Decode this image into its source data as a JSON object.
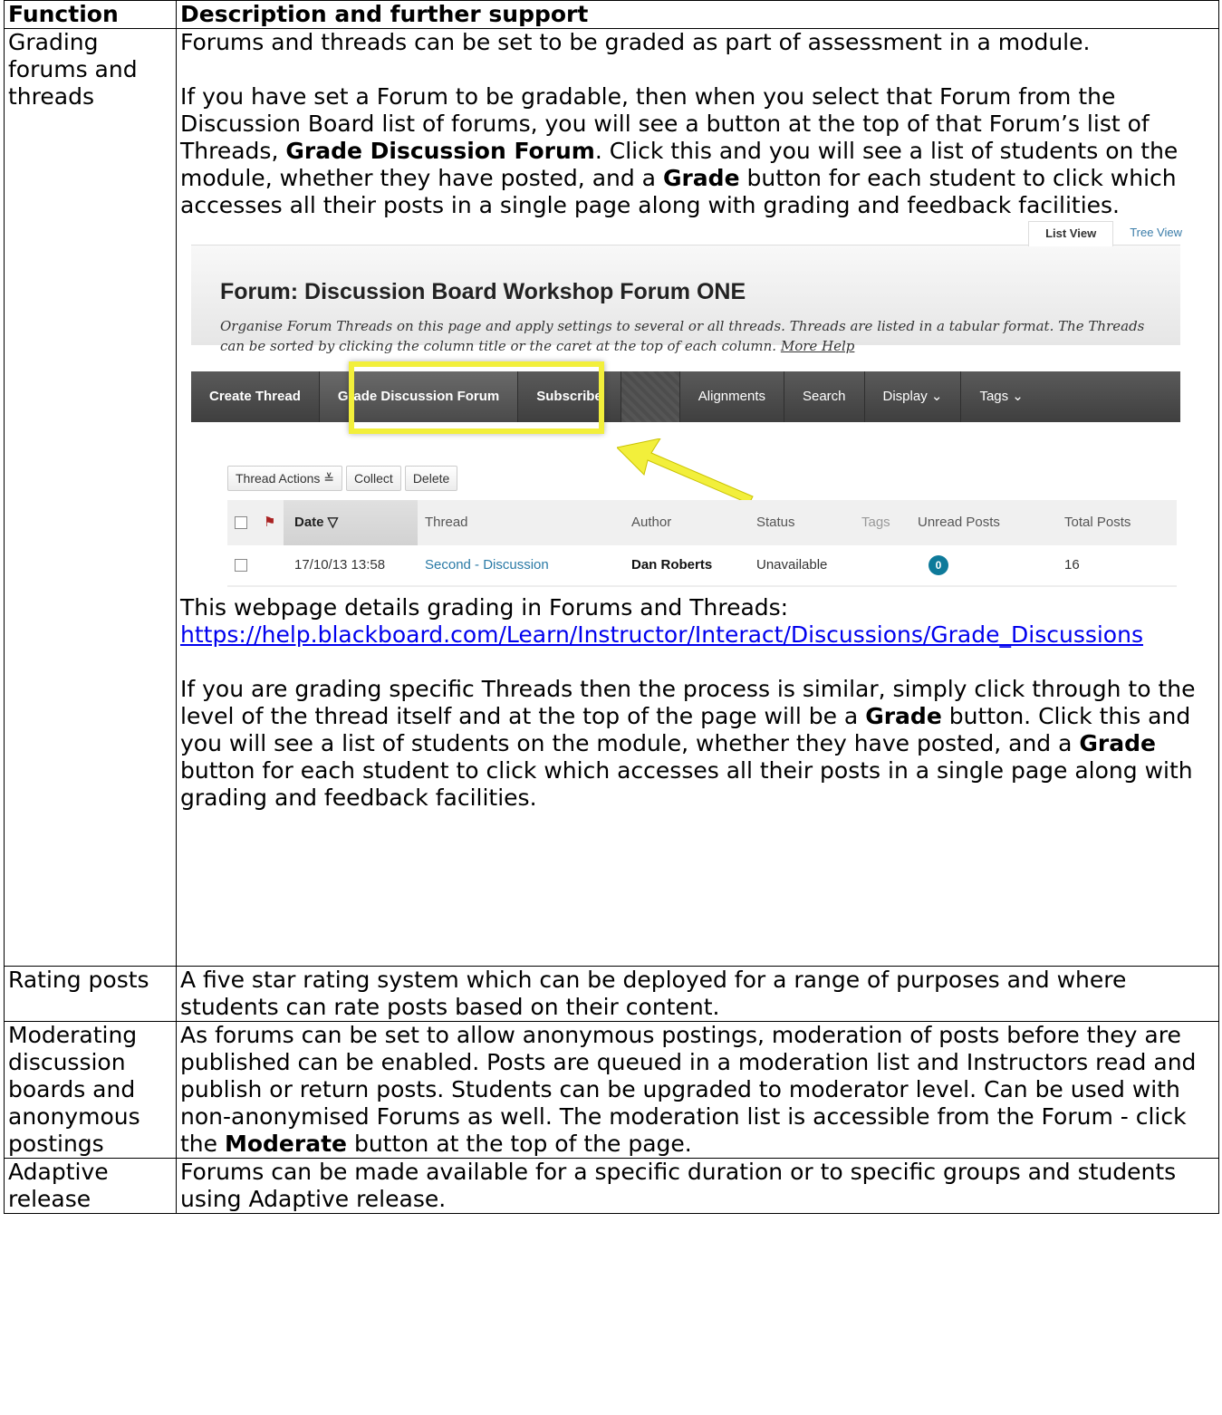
{
  "table": {
    "headers": {
      "function": "Function",
      "description": "Description and further support"
    }
  },
  "grading": {
    "function": "Grading forums and threads",
    "p1": "Forums and threads can be set to be graded as part of assessment in a module.",
    "p2_a": "If you have set a Forum to be gradable, then when you select that Forum from the Discussion Board list of forums, you will see a button at the top of that Forum’s list of Threads, ",
    "p2_b": "Grade Discussion Forum",
    "p2_c": ". Click this and you will see a list of students on the module, whether they have posted, and a ",
    "p2_d": "Grade",
    "p2_e": " button for each student to click which accesses all their posts in a single page along with grading and feedback facilities.",
    "p3": "This webpage  details grading in Forums and Threads:",
    "link": "https://help.blackboard.com/Learn/Instructor/Interact/Discussions/Grade_Discussions",
    "p4_a": "If you are grading specific Threads then the process is similar, simply click through to the level of the thread itself and at the top of the page will be a ",
    "p4_b": "Grade",
    "p4_c": " button. Click this and you will see a list of students on the module, whether they have posted, and a ",
    "p4_d": "Grade",
    "p4_e": " button for each student to click which accesses all their posts in a single page along with grading and feedback facilities."
  },
  "screenshot": {
    "view_tabs": [
      "List View",
      "Tree View"
    ],
    "forum_title": "Forum: Discussion Board Workshop Forum ONE",
    "forum_desc": "Organise Forum Threads on this page and apply settings to several or all threads. Threads are listed in a tabular format. The Threads can be sorted by clicking the column title or the caret at the top of each column.",
    "more_help": "More Help",
    "nav": {
      "create_thread": "Create Thread",
      "grade_forum": "Grade Discussion Forum",
      "subscribe": "Subscribe",
      "alignments": "Alignments",
      "search": "Search",
      "display": "Display ⌄",
      "tags": "Tags ⌄"
    },
    "actions": {
      "thread_actions": "Thread Actions ≚",
      "collect": "Collect",
      "delete": "Delete"
    },
    "columns": {
      "date": "Date ▽",
      "thread": "Thread",
      "author": "Author",
      "status": "Status",
      "tags": "Tags",
      "unread": "Unread Posts",
      "total": "Total Posts"
    },
    "row": {
      "date": "17/10/13 13:58",
      "thread": "Second - Discussion",
      "author": "Dan Roberts",
      "status": "Unavailable",
      "unread": "0",
      "total": "16"
    },
    "highlight_color": "#f2ef3b"
  },
  "rating": {
    "function": "Rating posts",
    "text": "A five star rating system which can be deployed for a range of purposes and where students can rate posts based on their content."
  },
  "moderating": {
    "function": "Moderating discussion boards and anonymous postings",
    "text_a": "As forums can be set to allow anonymous postings, moderation of posts before they are published can be enabled. Posts are queued in a moderation list and Instructors read and publish or return posts. Students can be upgraded to moderator level. Can be used with non-anonymised Forums as well. The moderation list is accessible from the Forum - click the ",
    "text_b": "Moderate",
    "text_c": " button at the top of the page."
  },
  "adaptive": {
    "function": "Adaptive release",
    "text": "Forums can be made available for a specific duration or to specific groups and students using Adaptive release."
  }
}
